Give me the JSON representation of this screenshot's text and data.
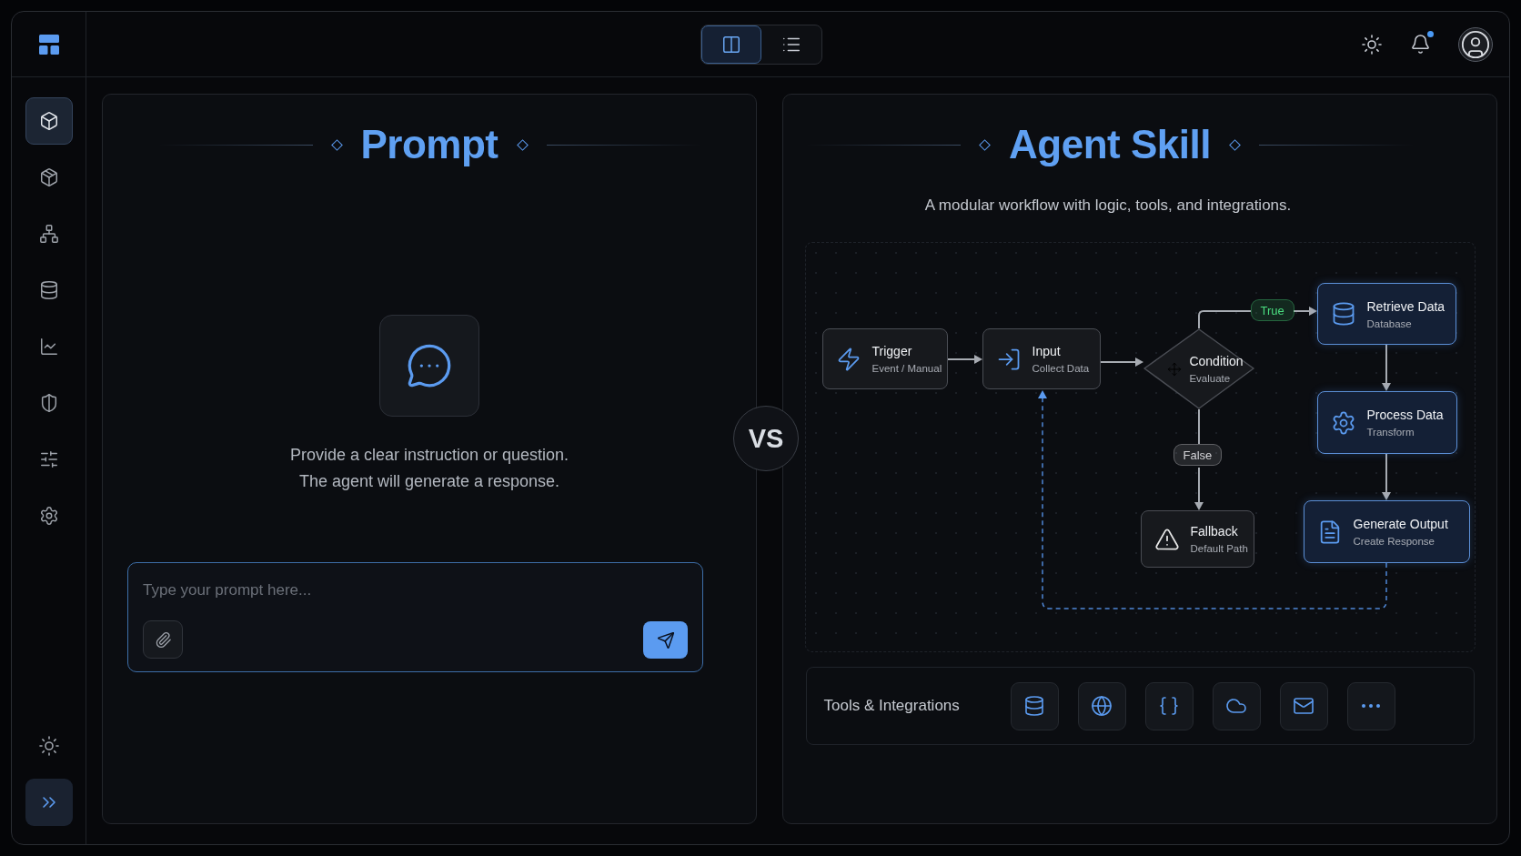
{
  "topbar": {
    "view_toggle": [
      {
        "selected": true
      },
      {
        "selected": false
      }
    ],
    "notification": true
  },
  "sidebar": {
    "items": [
      {
        "selected": true
      },
      {
        "selected": false
      },
      {
        "selected": false
      },
      {
        "selected": false
      },
      {
        "selected": false
      },
      {
        "selected": false
      },
      {
        "selected": false
      },
      {
        "selected": false
      }
    ]
  },
  "prompt_panel": {
    "title": "Prompt",
    "description": [
      "Provide a clear instruction or question.",
      "The agent will generate a response."
    ],
    "input": {
      "placeholder": "Type your prompt here..."
    }
  },
  "vs_badge": "VS",
  "skill_panel": {
    "title": "Agent Skill",
    "subtitle": "A modular workflow with logic, tools, and integrations.",
    "nodes": [
      {
        "title": "Trigger",
        "subtitle": "Event / Manual",
        "accent": false
      },
      {
        "title": "Input",
        "subtitle": "Collect Data",
        "accent": false
      },
      {
        "title": "Condition",
        "subtitle": "Evaluate",
        "accent": false
      },
      {
        "title": "Retrieve Data",
        "subtitle": "Database",
        "accent": true
      },
      {
        "title": "Process Data",
        "subtitle": "Transform",
        "accent": true
      },
      {
        "title": "Generate Output",
        "subtitle": "Create Response",
        "accent": true
      },
      {
        "title": "Fallback",
        "subtitle": "Default Path",
        "accent": false
      }
    ],
    "branches": [
      {
        "label": "True",
        "color": "#4ade80"
      },
      {
        "label": "False",
        "color": "#d4d4d8"
      }
    ],
    "tools": {
      "label": "Tools & Integrations"
    }
  }
}
